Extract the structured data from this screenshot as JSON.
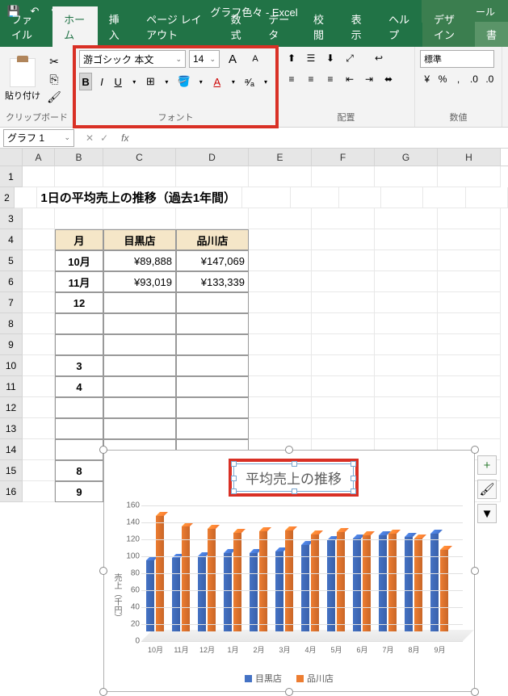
{
  "titlebar": {
    "title": "グラフ色々 - Excel",
    "context_label": "グラフ ツール"
  },
  "tabs": {
    "file": "ファイル",
    "home": "ホーム",
    "insert": "挿入",
    "layout": "ページ レイアウト",
    "formulas": "数式",
    "data": "データ",
    "review": "校閲",
    "view": "表示",
    "help": "ヘルプ",
    "design": "デザイン",
    "format": "書"
  },
  "ribbon": {
    "clipboard": {
      "label": "クリップボード",
      "paste": "貼り付け"
    },
    "font": {
      "label": "フォント",
      "name": "游ゴシック 本文",
      "size": "14"
    },
    "align": {
      "label": "配置"
    },
    "number": {
      "label": "数値",
      "format": "標準"
    }
  },
  "namebox": "グラフ 1",
  "sheet": {
    "title": "1日の平均売上の推移（過去1年間）",
    "headers": {
      "month": "月",
      "s1": "目黒店",
      "s2": "品川店"
    },
    "rows": [
      {
        "m": "10月",
        "v1": "¥89,888",
        "v2": "¥147,069"
      },
      {
        "m": "11月",
        "v1": "¥93,019",
        "v2": "¥133,339"
      },
      {
        "m": "12",
        "v1": "",
        "v2": ""
      },
      {
        "m": "",
        "v1": "",
        "v2": ""
      },
      {
        "m": "",
        "v1": "",
        "v2": ""
      },
      {
        "m": "3",
        "v1": "",
        "v2": ""
      },
      {
        "m": "4",
        "v1": "",
        "v2": ""
      },
      {
        "m": "",
        "v1": "",
        "v2": ""
      },
      {
        "m": "",
        "v1": "",
        "v2": ""
      },
      {
        "m": "",
        "v1": "",
        "v2": ""
      },
      {
        "m": "8",
        "v1": "",
        "v2": ""
      },
      {
        "m": "9",
        "v1": "",
        "v2": ""
      }
    ]
  },
  "chart_data": {
    "type": "bar",
    "title": "平均売上の推移",
    "ylabel": "売上（千円）",
    "ylim": [
      0,
      160
    ],
    "ystep": 20,
    "categories": [
      "10月",
      "11月",
      "12月",
      "1月",
      "2月",
      "3月",
      "4月",
      "5月",
      "6月",
      "7月",
      "8月",
      "9月"
    ],
    "series": [
      {
        "name": "目黒店",
        "color": "#4472c4",
        "values": [
          90,
          93,
          95,
          100,
          100,
          102,
          110,
          116,
          118,
          122,
          120,
          124
        ]
      },
      {
        "name": "品川店",
        "color": "#ed7d31",
        "values": [
          147,
          133,
          130,
          125,
          127,
          128,
          123,
          126,
          122,
          124,
          118,
          104
        ]
      }
    ]
  }
}
